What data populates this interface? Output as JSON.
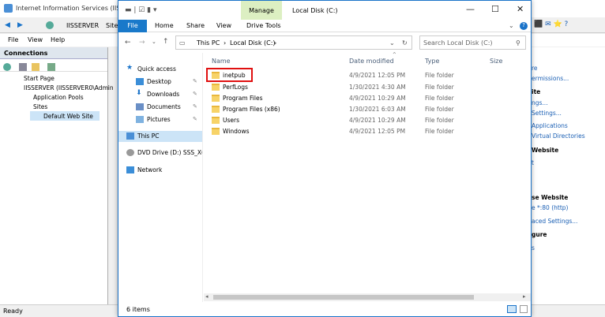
{
  "iis": {
    "title": "Internet Information Services (IIS) Ma",
    "address": [
      "IISSERVER",
      "Sites"
    ],
    "menu": [
      "File",
      "View",
      "Help"
    ],
    "connections_header": "Connections",
    "tree": [
      "Start Page",
      "IISSERVER (IISSERVER0\\Admin",
      "Application Pools",
      "Sites",
      "Default Web Site"
    ],
    "actions": [
      {
        "text": "re",
        "style": "lnk"
      },
      {
        "text": "ermissions...",
        "style": "lnk"
      },
      {
        "text": "ite",
        "style": "hd"
      },
      {
        "text": "ngs...",
        "style": "lnk"
      },
      {
        "text": "Settings...",
        "style": "lnk"
      },
      {
        "text": "Applications",
        "style": "lnk"
      },
      {
        "text": "Virtual Directories",
        "style": "lnk"
      },
      {
        "text": "Website",
        "style": "hd"
      },
      {
        "text": "t",
        "style": "lnk"
      },
      {
        "text": "se Website",
        "style": "hd"
      },
      {
        "text": "e *:80 (http)",
        "style": "lnk"
      },
      {
        "text": "aced Settings...",
        "style": "lnk"
      },
      {
        "text": "gure",
        "style": "hd"
      },
      {
        "text": "s",
        "style": "lnk"
      }
    ],
    "status": "Ready"
  },
  "explorer": {
    "title": "Local Disk (C:)",
    "manage": "Manage",
    "drive_tools": "Drive Tools",
    "ribbon": [
      "File",
      "Home",
      "Share",
      "View"
    ],
    "address": [
      "This PC",
      "Local Disk (C:)"
    ],
    "search_placeholder": "Search Local Disk (C:)",
    "nav": [
      {
        "label": "Quick access",
        "icon": "star-icon"
      },
      {
        "label": "Desktop",
        "icon": "desktop-icon"
      },
      {
        "label": "Downloads",
        "icon": "download-icon"
      },
      {
        "label": "Documents",
        "icon": "documents-icon"
      },
      {
        "label": "Pictures",
        "icon": "pictures-icon"
      },
      {
        "label": "This PC",
        "icon": "computer-icon"
      },
      {
        "label": "DVD Drive (D:) SSS_X6",
        "icon": "dvd-icon"
      },
      {
        "label": "Network",
        "icon": "network-icon"
      }
    ],
    "columns": [
      "Name",
      "Date modified",
      "Type",
      "Size"
    ],
    "files": [
      {
        "name": "inetpub",
        "date": "4/9/2021 12:05 PM",
        "type": "File folder"
      },
      {
        "name": "PerfLogs",
        "date": "1/30/2021 4:30 AM",
        "type": "File folder"
      },
      {
        "name": "Program Files",
        "date": "4/9/2021 10:29 AM",
        "type": "File folder"
      },
      {
        "name": "Program Files (x86)",
        "date": "1/30/2021 6:03 AM",
        "type": "File folder"
      },
      {
        "name": "Users",
        "date": "4/9/2021 10:29 AM",
        "type": "File folder"
      },
      {
        "name": "Windows",
        "date": "4/9/2021 12:05 PM",
        "type": "File folder"
      }
    ],
    "status": "6 items"
  }
}
